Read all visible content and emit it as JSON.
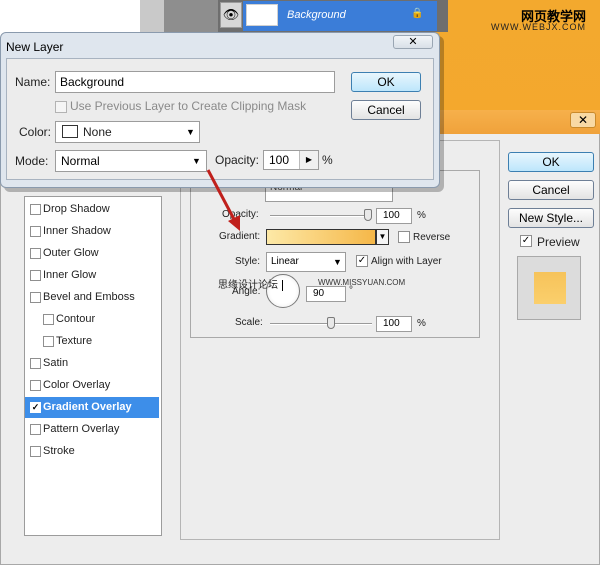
{
  "watermark": {
    "title": "网页教学网",
    "url": "WWW.WEBJX.COM",
    "mid_text": "思缘设计论坛",
    "mid_url": "WWW.MISSYUAN.COM"
  },
  "layers_panel": {
    "layer_name": "Background",
    "eye_icon": "eye-icon",
    "lock_icon": "lock-icon"
  },
  "new_layer_dialog": {
    "title": "New Layer",
    "close_symbol": "✕",
    "name_label": "Name:",
    "name_value": "Background",
    "clip_label": "Use Previous Layer to Create Clipping Mask",
    "color_label": "Color:",
    "color_value": "None",
    "mode_label": "Mode:",
    "mode_value": "Normal",
    "opacity_label": "Opacity:",
    "opacity_value": "100",
    "opacity_unit": "%",
    "ok_label": "OK",
    "cancel_label": "Cancel"
  },
  "layer_style_dialog": {
    "close_symbol": "✕",
    "styles": [
      {
        "label": "Drop Shadow",
        "checked": false,
        "indent": false
      },
      {
        "label": "Inner Shadow",
        "checked": false,
        "indent": false
      },
      {
        "label": "Outer Glow",
        "checked": false,
        "indent": false
      },
      {
        "label": "Inner Glow",
        "checked": false,
        "indent": false
      },
      {
        "label": "Bevel and Emboss",
        "checked": false,
        "indent": false
      },
      {
        "label": "Contour",
        "checked": false,
        "indent": true
      },
      {
        "label": "Texture",
        "checked": false,
        "indent": true
      },
      {
        "label": "Satin",
        "checked": false,
        "indent": false
      },
      {
        "label": "Color Overlay",
        "checked": false,
        "indent": false
      },
      {
        "label": "Gradient Overlay",
        "checked": true,
        "indent": false,
        "selected": true
      },
      {
        "label": "Pattern Overlay",
        "checked": false,
        "indent": false
      },
      {
        "label": "Stroke",
        "checked": false,
        "indent": false
      }
    ],
    "gradient_overlay": {
      "blend_mode_partial": "Normal",
      "opacity_label": "Opacity:",
      "opacity_value": "100",
      "opacity_unit": "%",
      "gradient_label": "Gradient:",
      "reverse_label": "Reverse",
      "reverse_checked": false,
      "style_label": "Style:",
      "style_value": "Linear",
      "align_label": "Align with Layer",
      "align_checked": true,
      "angle_label": "Angle:",
      "angle_value": "90",
      "angle_unit": "°",
      "scale_label": "Scale:",
      "scale_value": "100",
      "scale_unit": "%",
      "gradient_colors": [
        "#fde9a7",
        "#f5b748"
      ]
    },
    "ok_label": "OK",
    "cancel_label": "Cancel",
    "new_style_label": "New Style...",
    "preview_label": "Preview",
    "preview_checked": true
  },
  "colors": {
    "selection_blue": "#3d8ee9",
    "title_orange": "#f0a23b",
    "background_orange": "#f6a52a"
  }
}
